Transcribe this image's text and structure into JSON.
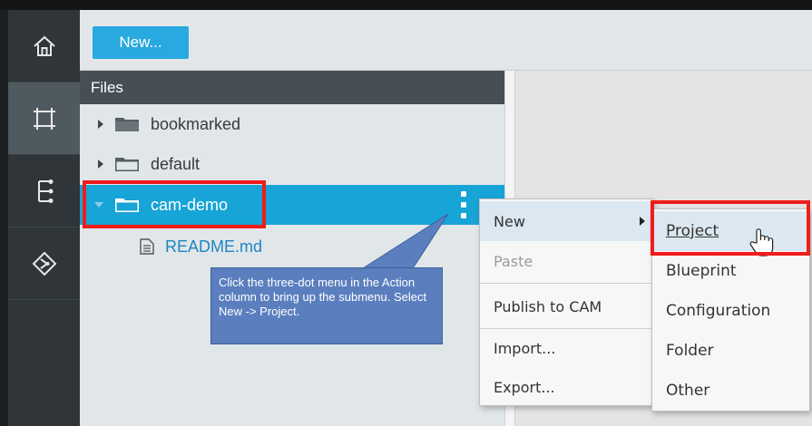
{
  "toolbar": {
    "new_label": "New..."
  },
  "files": {
    "header": "Files",
    "tree": [
      {
        "label": "bookmarked",
        "expanded": false,
        "selected": false
      },
      {
        "label": "default",
        "expanded": false,
        "selected": false
      },
      {
        "label": "cam-demo",
        "expanded": true,
        "selected": true
      }
    ],
    "child_file": "README.md"
  },
  "context_menu": {
    "items": [
      {
        "label": "New",
        "has_submenu": true,
        "state": "hover"
      },
      {
        "label": "Paste",
        "state": "disabled"
      },
      {
        "label": "Publish to CAM",
        "state": "normal"
      },
      {
        "label": "Import...",
        "state": "normal"
      },
      {
        "label": "Export...",
        "state": "normal"
      }
    ]
  },
  "submenu": {
    "items": [
      {
        "label": "Project",
        "state": "hover"
      },
      {
        "label": "Blueprint",
        "state": "normal"
      },
      {
        "label": "Configuration",
        "state": "normal"
      },
      {
        "label": "Folder",
        "state": "normal"
      },
      {
        "label": "Other",
        "state": "normal"
      }
    ]
  },
  "callout": {
    "text": "Click the three-dot menu in the Action column to bring up the submenu.  Select New -> Project."
  },
  "icons": {
    "rail": [
      "home-icon",
      "canvas-icon",
      "topology-icon",
      "deploy-icon"
    ],
    "tree": [
      "folder-icon",
      "document-icon",
      "kebab-menu-icon",
      "hand-cursor-icon"
    ]
  },
  "colors": {
    "accent": "#28a9e0",
    "selected_row": "#17a4d6",
    "highlight_border": "#ef1c1c",
    "callout": "#5b7fbe",
    "rail": "#2f3538"
  }
}
